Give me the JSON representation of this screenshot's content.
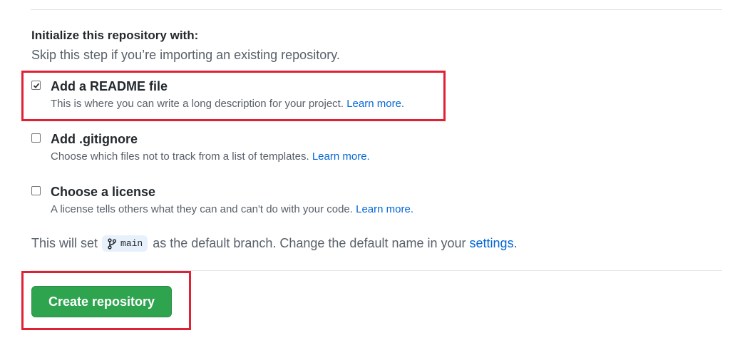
{
  "section": {
    "heading": "Initialize this repository with:",
    "subheading": "Skip this step if you’re importing an existing repository."
  },
  "options": [
    {
      "title": "Add a README file",
      "description": "This is where you can write a long description for your project.",
      "link": "Learn more.",
      "checked": true
    },
    {
      "title": "Add .gitignore",
      "description": "Choose which files not to track from a list of templates.",
      "link": "Learn more.",
      "checked": false
    },
    {
      "title": "Choose a license",
      "description": "A license tells others what they can and can't do with your code.",
      "link": "Learn more.",
      "checked": false
    }
  ],
  "branch": {
    "prefix": "This will set",
    "branch_name": "main",
    "middle": "as the default branch. Change the default name in your",
    "settings_link": "settings",
    "suffix": "."
  },
  "actions": {
    "create_label": "Create repository"
  },
  "icons": {
    "branch": "git-branch-icon",
    "checkbox_check": "check-icon"
  },
  "colors": {
    "primary_button": "#2ea44f",
    "link": "#0366d6",
    "highlight": "#e02033",
    "branch_pill_bg": "#e7f1fb"
  }
}
